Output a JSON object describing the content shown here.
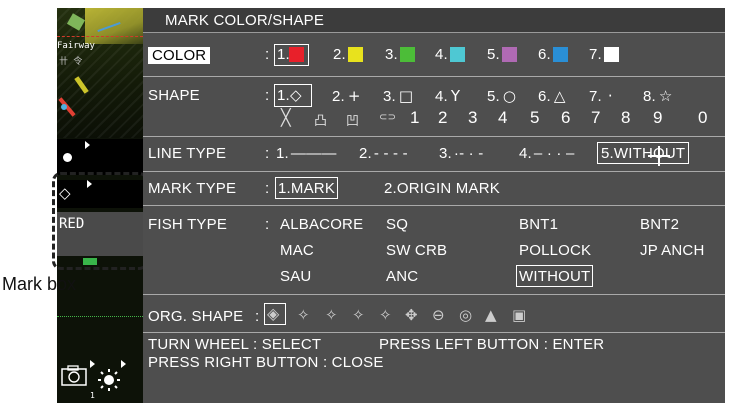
{
  "strip": {
    "fairway_label": "Fairway",
    "mark_color_label": "RED",
    "tray_index": "1"
  },
  "callout": {
    "label": "Mark box"
  },
  "menu": {
    "title": "MARK COLOR/SHAPE",
    "color": {
      "label": "COLOR",
      "options": [
        {
          "num": "1.",
          "color": "#e8202a"
        },
        {
          "num": "2.",
          "color": "#e8e21d"
        },
        {
          "num": "3.",
          "color": "#4cbd38"
        },
        {
          "num": "4.",
          "color": "#4ec8d3"
        },
        {
          "num": "5.",
          "color": "#b06ab4"
        },
        {
          "num": "6.",
          "color": "#2a8fd6"
        },
        {
          "num": "7.",
          "color": "#ffffff"
        }
      ]
    },
    "shape": {
      "label": "SHAPE",
      "options": [
        {
          "num": "1.",
          "glyph": "◇"
        },
        {
          "num": "2.",
          "glyph": "+"
        },
        {
          "num": "3.",
          "glyph": "□"
        },
        {
          "num": "4.",
          "glyph": "Y"
        },
        {
          "num": "5.",
          "glyph": "○"
        },
        {
          "num": "6.",
          "glyph": "△"
        },
        {
          "num": "7.",
          "glyph": "·"
        },
        {
          "num": "8.",
          "glyph": "☆"
        }
      ],
      "extra_glyphs": [
        "╳",
        "凸",
        "凹",
        "⊂⊃"
      ],
      "numbers": [
        "1",
        "2",
        "3",
        "4",
        "5",
        "6",
        "7",
        "8",
        "9",
        "0"
      ]
    },
    "line_type": {
      "label": "LINE TYPE",
      "options": [
        "1.",
        "2.",
        "3.",
        "4.",
        "5.WITHOUT"
      ],
      "styles": [
        "———",
        "- - - -",
        "·- · -",
        "– · · –",
        ""
      ]
    },
    "mark_type": {
      "label": "MARK TYPE",
      "options": [
        "1.MARK",
        "2.ORIGIN MARK"
      ]
    },
    "fish_type": {
      "label": "FISH TYPE",
      "options": [
        "ALBACORE",
        "SQ",
        "BNT1",
        "BNT2",
        "MAC",
        "SW CRB",
        "POLLOCK",
        "JP ANCH",
        "SAU",
        "ANC",
        "WITHOUT"
      ]
    },
    "org_shape": {
      "label": "ORG. SHAPE",
      "glyphs": [
        "◈",
        "✧",
        "✧",
        "✧",
        "✧",
        "✧",
        "⊖",
        "◎",
        "▲",
        "▣"
      ]
    },
    "help": {
      "line1_a": "TURN WHEEL : SELECT",
      "line1_b": "PRESS LEFT BUTTON : ENTER",
      "line2": "PRESS RIGHT BUTTON : CLOSE"
    },
    "colon": ":"
  }
}
